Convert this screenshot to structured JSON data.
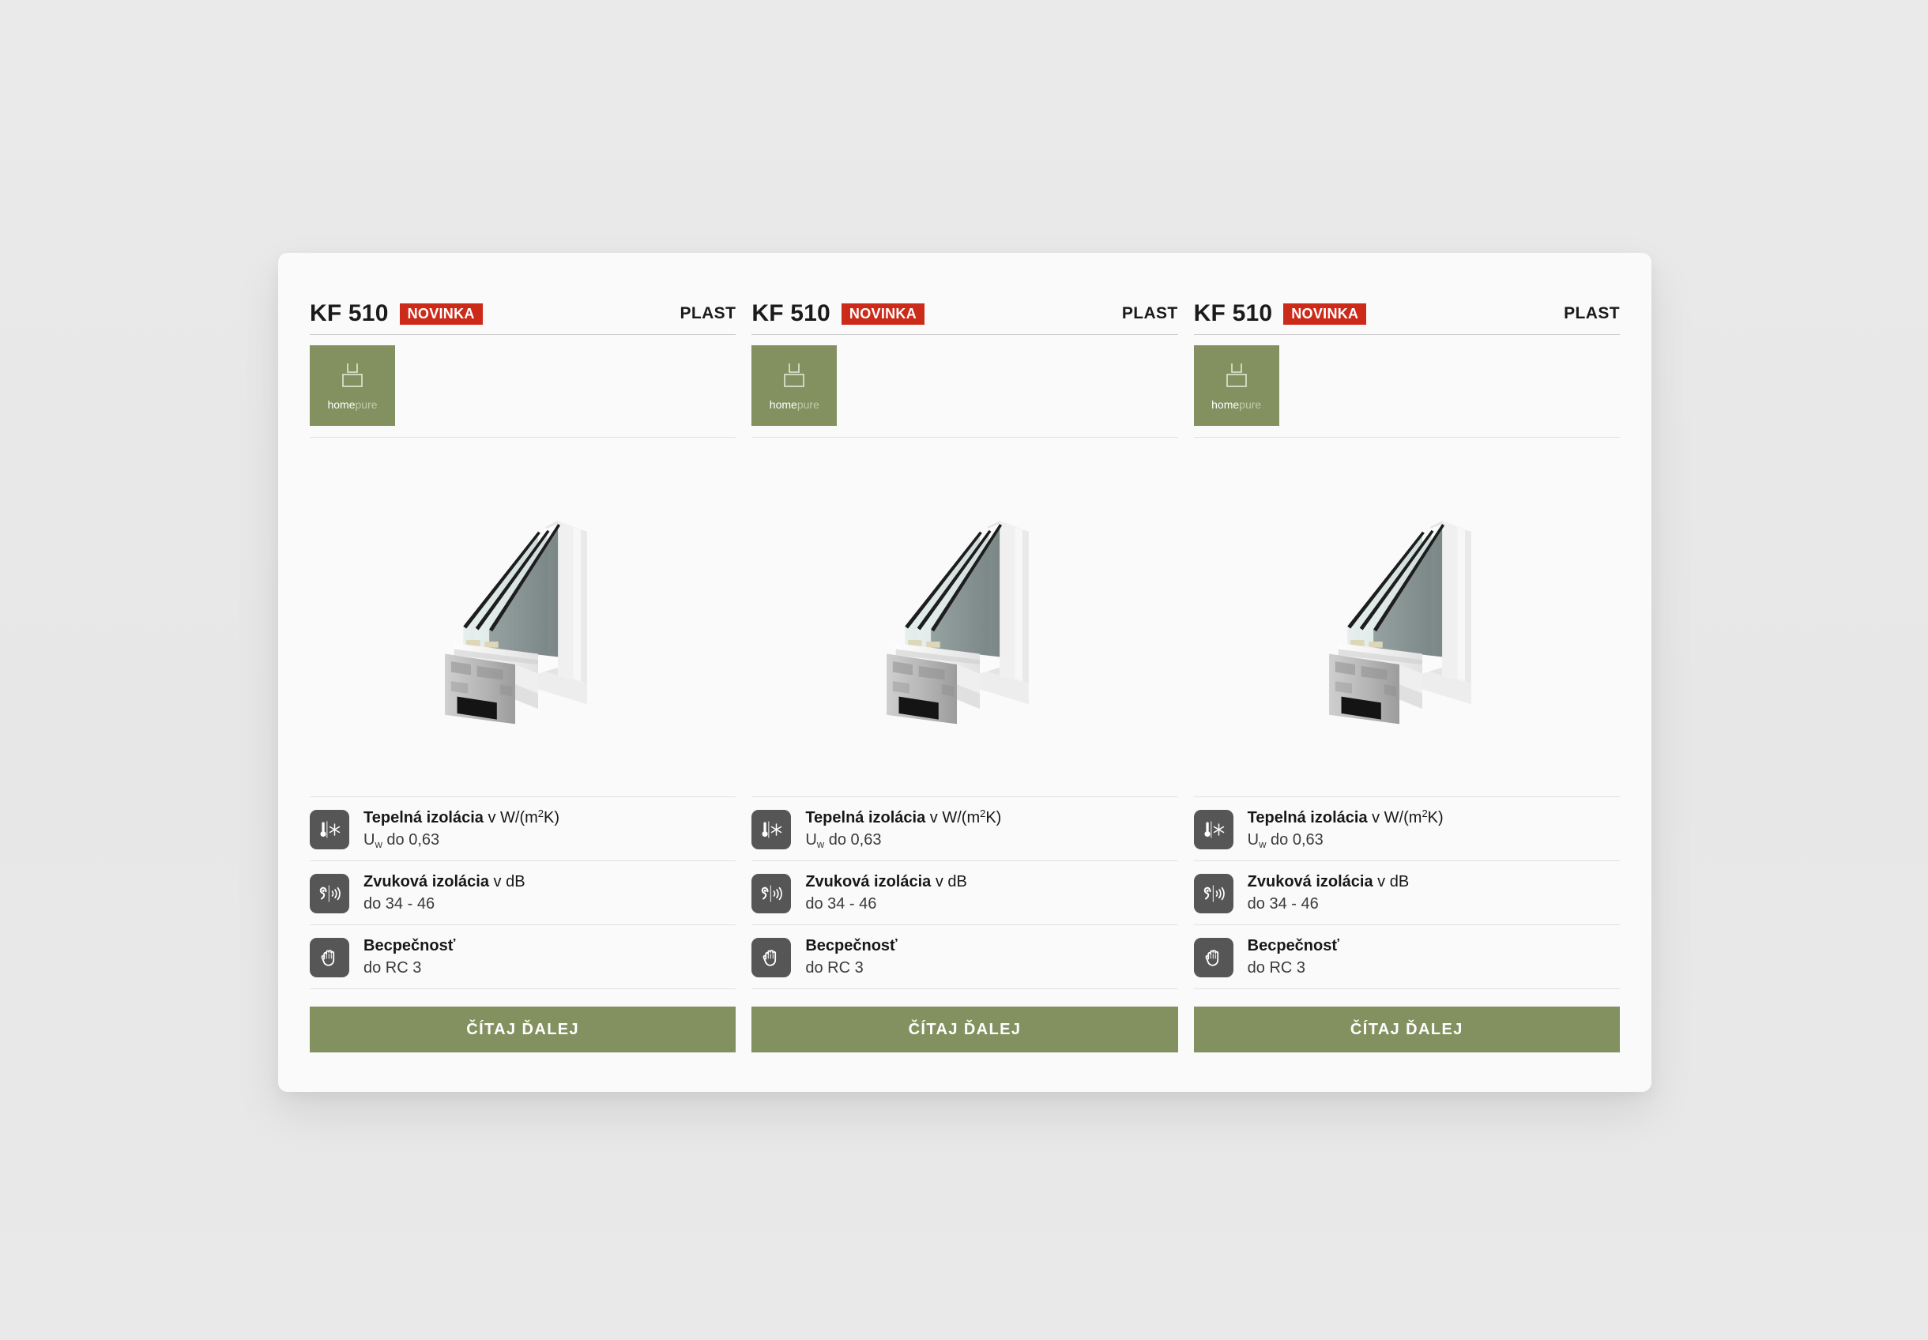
{
  "theme": {
    "background": "#e9e9e9",
    "panel_bg": "#fafafa",
    "accent_green": "#83905f",
    "badge_red": "#cc2b1a",
    "icon_tile": "#565656"
  },
  "cards": [
    {
      "model": "KF 510",
      "badge": "NOVINKA",
      "material": "PLAST",
      "brand": {
        "name_bold": "home",
        "name_light": "pure",
        "icon": "window-glyph-icon"
      },
      "product_image_alt": "window-cross-section",
      "features": [
        {
          "icon": "thermometer-snowflake-icon",
          "title_strong": "Tepelná izolácia",
          "title_light": " v W/(m²K)",
          "value_prefix": "U",
          "value_sub": "w",
          "value_rest": " do 0,63"
        },
        {
          "icon": "ear-soundwave-icon",
          "title_strong": "Zvuková izolácia",
          "title_light": " v dB",
          "value": "do 34 - 46"
        },
        {
          "icon": "open-hand-icon",
          "title_strong": "Becpečnosť",
          "title_light": "",
          "value": "do RC 3"
        }
      ],
      "cta_label": "ČÍTAJ ĎALEJ"
    },
    {
      "model": "KF 510",
      "badge": "NOVINKA",
      "material": "PLAST",
      "brand": {
        "name_bold": "home",
        "name_light": "pure",
        "icon": "window-glyph-icon"
      },
      "product_image_alt": "window-cross-section",
      "features": [
        {
          "icon": "thermometer-snowflake-icon",
          "title_strong": "Tepelná izolácia",
          "title_light": " v W/(m²K)",
          "value_prefix": "U",
          "value_sub": "w",
          "value_rest": " do 0,63"
        },
        {
          "icon": "ear-soundwave-icon",
          "title_strong": "Zvuková izolácia",
          "title_light": " v dB",
          "value": "do 34 - 46"
        },
        {
          "icon": "open-hand-icon",
          "title_strong": "Becpečnosť",
          "title_light": "",
          "value": "do RC 3"
        }
      ],
      "cta_label": "ČÍTAJ ĎALEJ"
    },
    {
      "model": "KF 510",
      "badge": "NOVINKA",
      "material": "PLAST",
      "brand": {
        "name_bold": "home",
        "name_light": "pure",
        "icon": "window-glyph-icon"
      },
      "product_image_alt": "window-cross-section",
      "features": [
        {
          "icon": "thermometer-snowflake-icon",
          "title_strong": "Tepelná izolácia",
          "title_light": " v W/(m²K)",
          "value_prefix": "U",
          "value_sub": "w",
          "value_rest": " do 0,63"
        },
        {
          "icon": "ear-soundwave-icon",
          "title_strong": "Zvuková izolácia",
          "title_light": " v dB",
          "value": "do 34 - 46"
        },
        {
          "icon": "open-hand-icon",
          "title_strong": "Becpečnosť",
          "title_light": "",
          "value": "do RC 3"
        }
      ],
      "cta_label": "ČÍTAJ ĎALEJ"
    }
  ]
}
